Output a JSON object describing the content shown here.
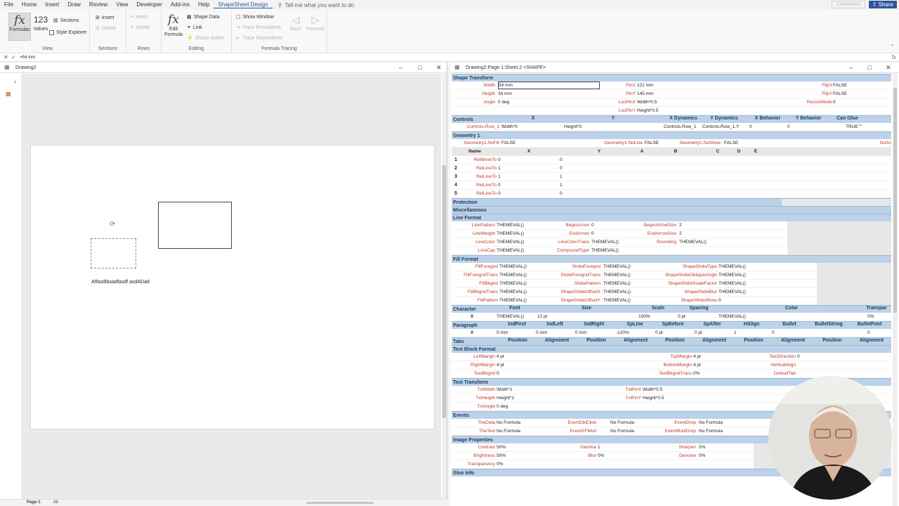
{
  "menu": {
    "items": [
      "File",
      "Home",
      "Insert",
      "Draw",
      "Review",
      "View",
      "Developer",
      "Add-ins",
      "Help",
      "ShapeSheet Design"
    ],
    "active_index": 9,
    "tell_me": "Tell me what you want to do",
    "comments": "Comments",
    "share": "Share"
  },
  "ribbon": {
    "view": {
      "formulas": "Formulas",
      "values_num": "123",
      "values": "Values",
      "sections": "Sections",
      "style_explorer": "Style Explorer",
      "label": "View"
    },
    "sections": {
      "insert": "Insert",
      "delete": "Delete",
      "label": "Sections"
    },
    "rows": {
      "insert": "Insert",
      "delete": "Delete",
      "label": "Rows"
    },
    "editing": {
      "edit_formula": "Edit Formula",
      "shape_data": "Shape Data",
      "link": "Link",
      "shape_action": "Shape Action",
      "label": "Editing"
    },
    "tracing": {
      "show_window": "Show Window",
      "trace_precedents": "Trace Precedents",
      "trace_dependents": "Trace Dependents",
      "back": "Back",
      "forward": "Forward",
      "label": "Formula Tracing"
    }
  },
  "formula_bar": {
    "value": "=54 mm"
  },
  "drawing": {
    "title": "Drawing2",
    "shape_text": "Affasdfasadfasdf asdADad",
    "page_tab": "Page-1",
    "all_tab": "All"
  },
  "shapesheet": {
    "title": "Drawing2:Page-1:Sheet.2 <SHAPE>",
    "shape_transform": {
      "title": "Shape Transform",
      "left": [
        [
          "Width",
          "54 mm"
        ],
        [
          "Height",
          "34 mm"
        ],
        [
          "Angle",
          "0 deg"
        ]
      ],
      "mid": [
        [
          "PinX",
          "121 mm"
        ],
        [
          "PinY",
          "145 mm"
        ],
        [
          "LocPinX",
          "Width*0.5"
        ],
        [
          "LocPinY",
          "Height*0.5"
        ]
      ],
      "right": [
        [
          "FlipX",
          "FALSE"
        ],
        [
          "FlipY",
          "FALSE"
        ],
        [
          "ResizeMode",
          "0"
        ]
      ]
    },
    "controls": {
      "title": "Controls",
      "cols": [
        "X",
        "Y",
        "X Dynamics",
        "Y Dynamics",
        "X Behavior",
        "Y Behavior",
        "Can Glue"
      ],
      "row": {
        "name": "Controls.Row_1",
        "x": "Width*0",
        "y": "Height*0",
        "xdyn": "Controls.Row_1",
        "ydyn": "Controls.Row_1.Y",
        "xbeh": "0",
        "ybeh": "0",
        "glue": "TRUE",
        "tip": "\"\""
      }
    },
    "geometry": {
      "title": "Geometry 1",
      "flags": [
        [
          "Geometry1.NoFill",
          "FALSE"
        ],
        [
          "Geometry1.NoLine",
          "FALSE"
        ],
        [
          "Geometry1.NoShow",
          "FALSE"
        ],
        [
          "NoSn",
          ""
        ]
      ],
      "cols": [
        "Name",
        "X",
        "Y",
        "A",
        "B",
        "C",
        "D",
        "E"
      ],
      "rows": [
        [
          "1",
          "RelMoveTo",
          "0",
          "0"
        ],
        [
          "2",
          "RelLineTo",
          "1",
          "0"
        ],
        [
          "3",
          "RelLineTo",
          "1",
          "1"
        ],
        [
          "4",
          "RelLineTo",
          "0",
          "1"
        ],
        [
          "5",
          "RelLineTo",
          "0",
          "0"
        ]
      ]
    },
    "protection": "Protection",
    "miscellaneous": "Miscellaneous",
    "line_format": {
      "title": "Line Format",
      "c1": [
        [
          "LinePattern",
          "THEMEVAL()"
        ],
        [
          "LineWeight",
          "THEMEVAL()"
        ],
        [
          "LineColor",
          "THEMEVAL()"
        ],
        [
          "LineCap",
          "THEMEVAL()"
        ]
      ],
      "c2": [
        [
          "BeginArrow",
          "0"
        ],
        [
          "EndArrow",
          "0"
        ],
        [
          "LineColorTrans",
          "THEMEVAL()"
        ],
        [
          "CompoundType",
          "THEMEVAL()"
        ]
      ],
      "c3": [
        [
          "BeginArrowSize",
          "2"
        ],
        [
          "EndArrowSize",
          "2"
        ],
        [
          "Rounding",
          "THEMEVAL()"
        ]
      ]
    },
    "fill_format": {
      "title": "Fill Format",
      "c1": [
        [
          "FillForegnd",
          "THEMEVAL()"
        ],
        [
          "FillForegndTrans",
          "THEMEVAL()"
        ],
        [
          "FillBkgnd",
          "THEMEVAL()"
        ],
        [
          "FillBkgndTrans",
          "THEMEVAL()"
        ],
        [
          "FillPattern",
          "THEMEVAL()"
        ]
      ],
      "c2": [
        [
          "ShdwForegnd",
          "THEMEVAL()"
        ],
        [
          "ShdwForegndTrans",
          "THEMEVAL()"
        ],
        [
          "ShdwPattern",
          "THEMEVAL()"
        ],
        [
          "ShapeShdwOffsetX",
          "THEMEVAL()"
        ],
        [
          "ShapeShdwOffsetY",
          "THEMEVAL()"
        ]
      ],
      "c3": [
        [
          "ShapeShdwType",
          "THEMEVAL()"
        ],
        [
          "ShapeShdwObliqueAngle",
          "THEMEVAL()"
        ],
        [
          "ShapeShdwScaleFactor",
          "THEMEVAL()"
        ],
        [
          "ShapeShdwBlur",
          "THEMEVAL()"
        ],
        [
          "ShapeShdwShow",
          "0"
        ]
      ]
    },
    "character": {
      "title": "Character",
      "cols": [
        "Font",
        "Size",
        "Scale",
        "Spacing",
        "Color",
        "Transpar"
      ],
      "row": [
        "0",
        "THEMEVAL()",
        "12 pt",
        "100%",
        "0 pt",
        "THEMEVAL()",
        "0%"
      ]
    },
    "paragraph": {
      "title": "Paragraph",
      "cols": [
        "IndFirst",
        "IndLeft",
        "IndRight",
        "SpLine",
        "SpBefore",
        "SpAfter",
        "HAlign",
        "Bullet",
        "BulletString",
        "BulletFont"
      ],
      "row": [
        "0",
        "0 mm",
        "0 mm",
        "0 mm",
        "-120%",
        "0 pt",
        "0 pt",
        "1",
        "0",
        "",
        "0"
      ]
    },
    "tabs": {
      "title": "Tabs",
      "cols": [
        "Position",
        "Alignment",
        "Position",
        "Alignment",
        "Position",
        "Alignment",
        "Position",
        "Alignment",
        "Position",
        "Alignment"
      ]
    },
    "text_block": {
      "title": "Text Block Format",
      "c1": [
        [
          "LeftMargin",
          "4 pt"
        ],
        [
          "RightMargin",
          "4 pt"
        ],
        [
          "TextBkgnd",
          "0"
        ]
      ],
      "c2": [
        [
          "TopMargin",
          "4 pt"
        ],
        [
          "BottomMargin",
          "4 pt"
        ],
        [
          "TextBkgndTrans",
          "0%"
        ]
      ],
      "c3": [
        [
          "TextDirection",
          "0"
        ],
        [
          "VerticalAlign",
          ""
        ],
        [
          "DefaultTab",
          ""
        ]
      ]
    },
    "text_transform": {
      "title": "Text Transform",
      "c1": [
        [
          "TxtWidth",
          "Width*1"
        ],
        [
          "TxtHeight",
          "Height*1"
        ],
        [
          "TxtAngle",
          "0 deg"
        ]
      ],
      "c2": [
        [
          "TxtPinX",
          "Width*0.5"
        ],
        [
          "TxtPinY",
          "Height*0.5"
        ]
      ]
    },
    "events": {
      "title": "Events",
      "c1": [
        [
          "TheData",
          "No Formula"
        ],
        [
          "TheText",
          "No Formula"
        ]
      ],
      "c2": [
        [
          "EventDblClick",
          "No Formula"
        ],
        [
          "EventXFMod",
          "No Formula"
        ]
      ],
      "c3": [
        [
          "EventDrop",
          "No Formula"
        ],
        [
          "EventMultiDrop",
          "No Formula"
        ]
      ]
    },
    "image": {
      "title": "Image Properties",
      "c1": [
        [
          "Contrast",
          "50%"
        ],
        [
          "Brightness",
          "50%"
        ],
        [
          "Transparency",
          "0%"
        ]
      ],
      "c2": [
        [
          "Gamma",
          "1"
        ],
        [
          "Blur",
          "0%"
        ]
      ],
      "c3": [
        [
          "Sharpen",
          "0%"
        ],
        [
          "Denoise",
          "0%"
        ]
      ]
    },
    "glue_info": "Glue Info"
  },
  "colors": {
    "accent": "#2b579a",
    "section_header": "#bcd2e8",
    "cell_name": "#c0392b"
  }
}
